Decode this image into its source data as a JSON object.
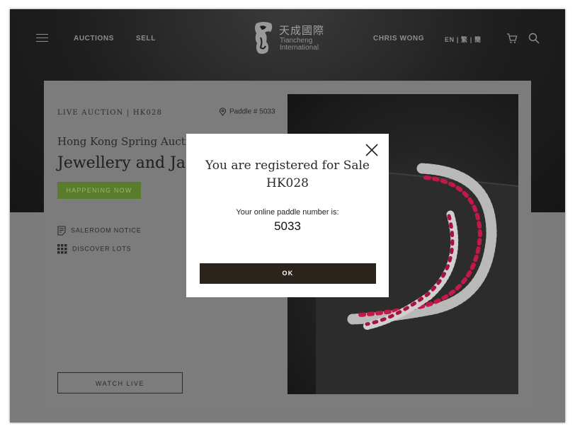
{
  "nav": {
    "links": [
      "AUCTIONS",
      "SELL"
    ],
    "user_name": "CHRIS WONG",
    "languages": [
      "EN",
      "繁",
      "簡"
    ],
    "separator": "|"
  },
  "logo": {
    "chinese": "天成國際",
    "english_line1": "Tiancheng",
    "english_line2": "International"
  },
  "sale": {
    "code_label": "LIVE AUCTION | HK028",
    "paddle_label": "Paddle # 5033",
    "subtitle": "Hong Kong Spring Auctio",
    "title": "Jewellery and Jade",
    "status": "HAPPENING NOW",
    "links": [
      "SALEROOM NOTICE",
      "DISCOVER LOTS"
    ],
    "watch_label": "WATCH LIVE"
  },
  "modal": {
    "title_line1": "You are registered for Sale",
    "title_line2": "HK028",
    "paddle_caption": "Your online paddle number is:",
    "paddle_number": "5033",
    "ok_label": "OK"
  },
  "icons": {
    "menu": "hamburger-icon",
    "cart": "cart-icon",
    "search": "search-icon",
    "paddle": "location-pin-icon",
    "notice": "document-icon",
    "lots": "grid-icon",
    "close": "close-icon"
  },
  "colors": {
    "status_green": "#5a7d2d",
    "ok_button": "#2b241d",
    "ruby": "#c4174a"
  }
}
